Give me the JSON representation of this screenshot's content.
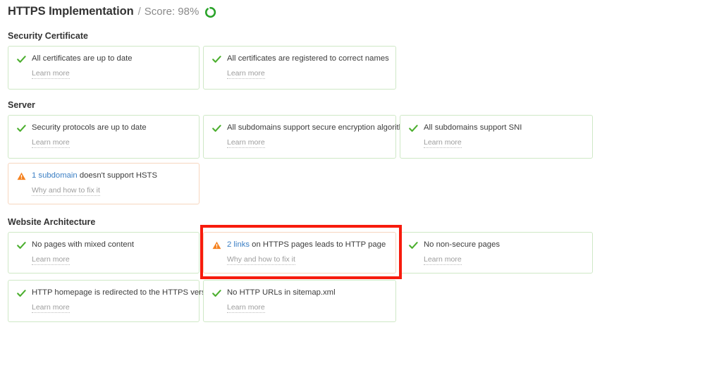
{
  "header": {
    "title": "HTTPS Implementation",
    "separator": "/",
    "score_label": "Score: 98%",
    "score_value": 98,
    "ring_icon": "progress-ring-icon",
    "ring_color": "#29a329"
  },
  "colors": {
    "ok_border": "#cfe8c6",
    "warn_border": "#f7d6bf",
    "ok_icon": "#4caf2f",
    "warn_icon": "#f58220",
    "link": "#3b7fc4",
    "muted_link": "#9d9d9d",
    "annotation": "#f71b0d"
  },
  "links": {
    "learn_more": "Learn more",
    "why_and_how": "Why and how to fix it"
  },
  "sections": [
    {
      "id": "security-certificate",
      "title": "Security Certificate",
      "items": [
        {
          "status": "ok",
          "icon": "check-icon",
          "text": "All certificates are up to date",
          "link": "Learn more"
        },
        {
          "status": "ok",
          "icon": "check-icon",
          "text": "All certificates are registered to correct names",
          "link": "Learn more"
        }
      ]
    },
    {
      "id": "server",
      "title": "Server",
      "items": [
        {
          "status": "ok",
          "icon": "check-icon",
          "text": "Security protocols are up to date",
          "link": "Learn more"
        },
        {
          "status": "ok",
          "icon": "check-icon",
          "text": "All subdomains support secure encryption algorithms",
          "link": "Learn more"
        },
        {
          "status": "ok",
          "icon": "check-icon",
          "text": "All subdomains support SNI",
          "link": "Learn more"
        },
        {
          "status": "warn",
          "icon": "warning-triangle-icon",
          "highlight": "1 subdomain",
          "text": " doesn't support HSTS",
          "link": "Why and how to fix it"
        }
      ]
    },
    {
      "id": "website-architecture",
      "title": "Website Architecture",
      "items": [
        {
          "status": "ok",
          "icon": "check-icon",
          "text": "No pages with mixed content",
          "link": "Learn more"
        },
        {
          "status": "warn",
          "icon": "warning-triangle-icon",
          "highlight": "2 links",
          "text": " on HTTPS pages leads to HTTP page",
          "link": "Why and how to fix it",
          "annotated": true
        },
        {
          "status": "ok",
          "icon": "check-icon",
          "text": "No non-secure pages",
          "link": "Learn more"
        },
        {
          "status": "ok",
          "icon": "check-icon",
          "text": "HTTP homepage is redirected to the HTTPS version",
          "link": "Learn more"
        },
        {
          "status": "ok",
          "icon": "check-icon",
          "text": "No HTTP URLs in sitemap.xml",
          "link": "Learn more"
        }
      ]
    }
  ]
}
